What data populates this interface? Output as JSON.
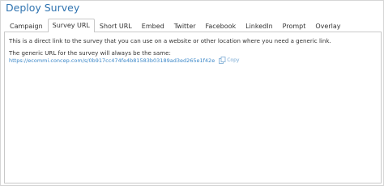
{
  "dialog": {
    "title": "Deploy Survey"
  },
  "tabs": [
    {
      "label": "Campaign"
    },
    {
      "label": "Survey URL"
    },
    {
      "label": "Short URL"
    },
    {
      "label": "Embed"
    },
    {
      "label": "Twitter"
    },
    {
      "label": "Facebook"
    },
    {
      "label": "LinkedIn"
    },
    {
      "label": "Prompt"
    },
    {
      "label": "Overlay"
    }
  ],
  "active_tab": "Survey URL",
  "survey_url_panel": {
    "intro_text": "This is a direct link to the survey that you can use on a website or other location where you need a generic link.",
    "generic_label": "The generic URL for the survey will always be the same:",
    "url": "https://ecommi.concep.com/s/0b917cc474fe4b81583b03189ad3ed265e1f42e",
    "copy_label": "Copy",
    "copy_icon": "copy-icon"
  },
  "colors": {
    "title": "#2f73b0",
    "link": "#3a87c8",
    "border": "#c9c9c9"
  }
}
